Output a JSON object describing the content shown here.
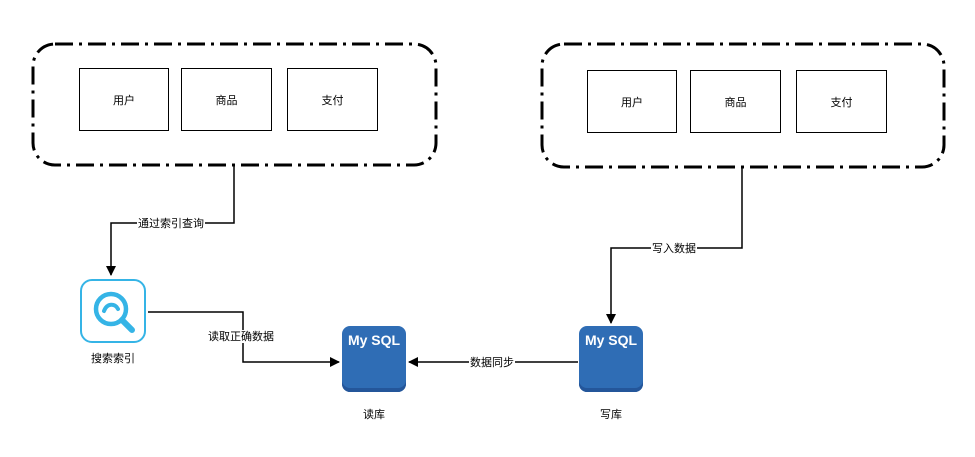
{
  "left_group": {
    "items": [
      "用户",
      "商品",
      "支付"
    ]
  },
  "right_group": {
    "items": [
      "用户",
      "商品",
      "支付"
    ]
  },
  "edges": {
    "query_by_index": "通过索引查询",
    "write_data": "写入数据",
    "read_correct_data": "读取正确数据",
    "data_sync": "数据同步"
  },
  "nodes": {
    "search_index": "搜索索引",
    "read_db": {
      "logo": "My SQL",
      "caption": "读库"
    },
    "write_db": {
      "logo": "My SQL",
      "caption": "写库"
    }
  },
  "colors": {
    "db": "#2f6db5",
    "search_icon": "#35b4e6",
    "stroke": "#000000"
  },
  "icons": {
    "search_index": "search-magnifier-icon",
    "db": "mysql-database-icon"
  }
}
